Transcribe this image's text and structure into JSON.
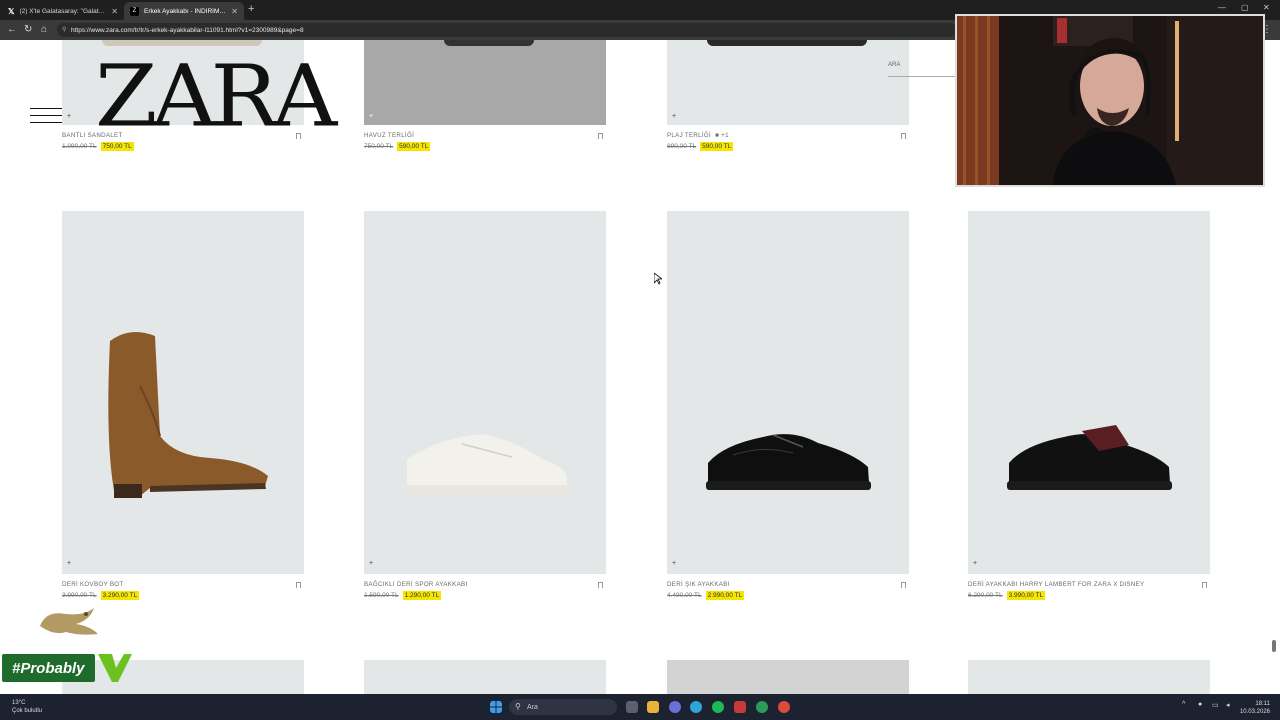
{
  "browser": {
    "tabs": [
      {
        "title": "(2) X'te Galatasaray: \"Galatasaray\"...",
        "active": false,
        "icon": "x-logo-icon"
      },
      {
        "title": "Erkek Ayakkabı - İNDİRİM | ZARA",
        "active": true,
        "icon": "zara-favicon-icon"
      }
    ],
    "url": "https://www.zara.com/tr/tr/s-erkek-ayakkabilar-l11091.html?v1=2300989&page=8"
  },
  "header": {
    "logo": "ZARA",
    "search_label": "ARA"
  },
  "products_row1": [
    {
      "name": "BANTLI SANDALET",
      "old_price": "1.090,00 TL",
      "new_price": "750,00 TL"
    },
    {
      "name": "HAVUZ TERLİĞİ",
      "old_price": "750,00 TL",
      "new_price": "590,00 TL"
    },
    {
      "name": "PLAJ TERLİĞİ",
      "extra": "■ +1",
      "old_price": "890,00 TL",
      "new_price": "590,00 TL"
    }
  ],
  "products_row2": [
    {
      "name": "DERİ KOVBOY BOT",
      "old_price": "3.990,00 TL",
      "new_price": "3.290,00 TL"
    },
    {
      "name": "BAĞCIKLI DERİ SPOR AYAKKABI",
      "old_price": "1.590,00 TL",
      "new_price": "1.290,00 TL"
    },
    {
      "name": "DERİ ŞIK AYAKKABI",
      "old_price": "4.490,00 TL",
      "new_price": "2.990,00 TL"
    },
    {
      "name": "DERİ AYAKKABI HARRY LAMBERT FOR ZARA X DISNEY",
      "old_price": "6.290,00 TL",
      "new_price": "3.990,00 TL"
    }
  ],
  "overlay": {
    "badge_text": "#Probably"
  },
  "taskbar": {
    "search_placeholder": "Ara",
    "weather_temp": "13°C",
    "weather_desc": "Çok bulutlu",
    "time": "18:11",
    "date": "10.03.2026"
  }
}
